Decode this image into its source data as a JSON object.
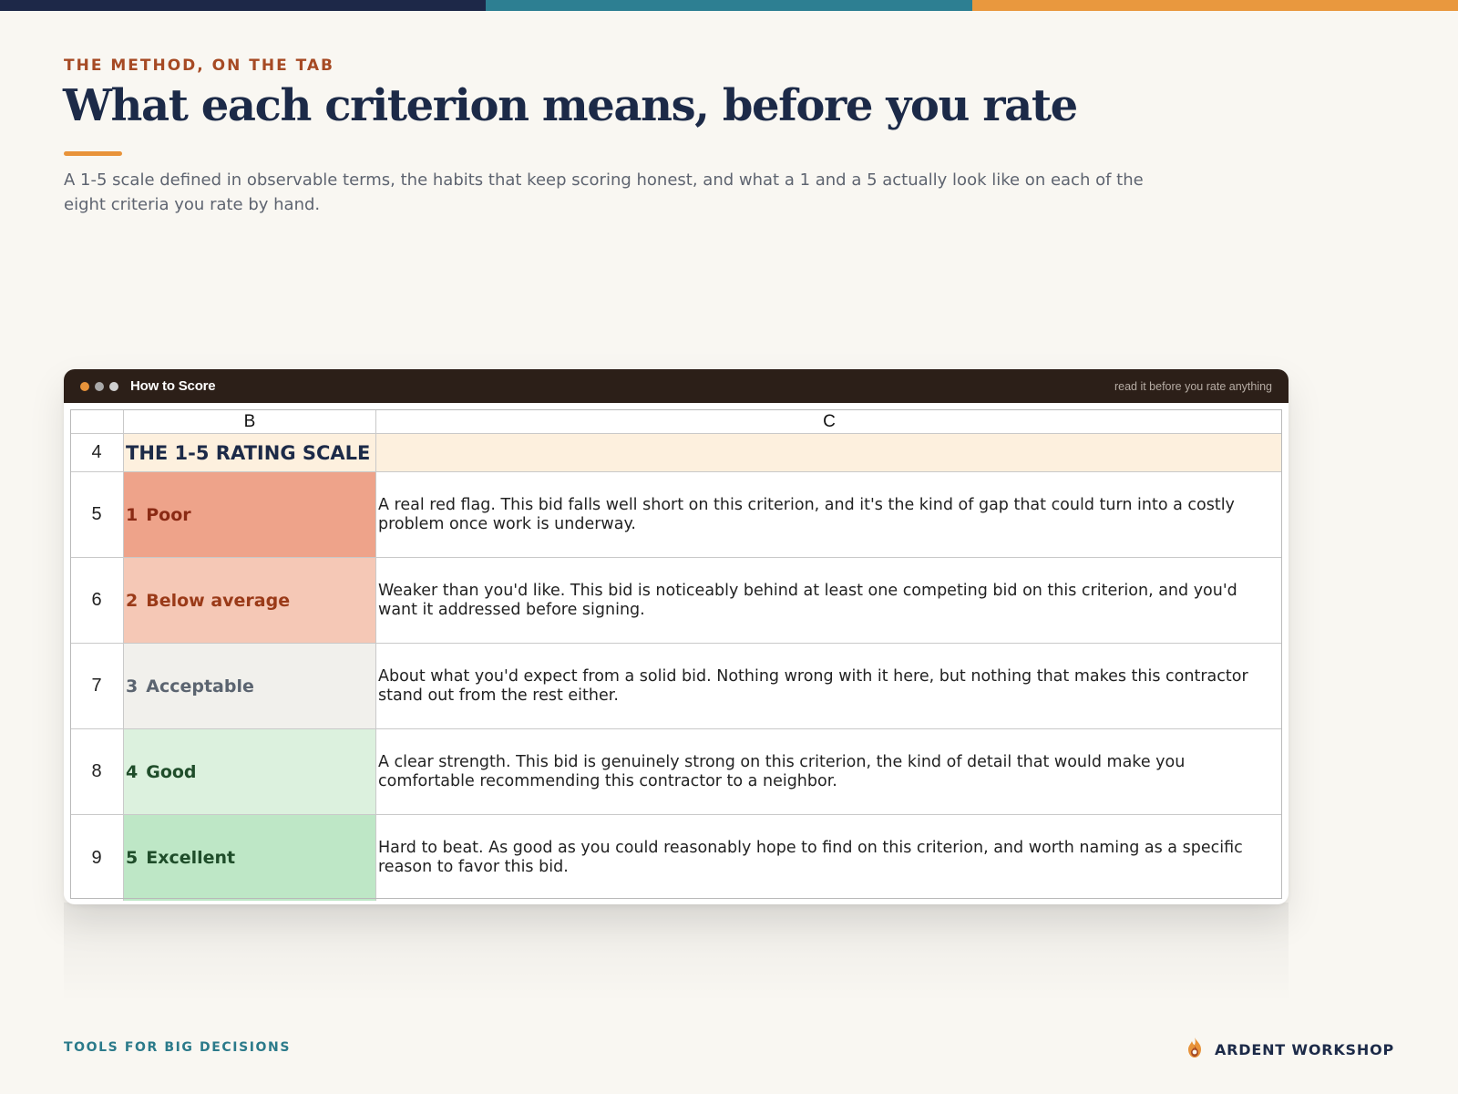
{
  "colors": {
    "top_bar": [
      "#1d2848",
      "#2d7f92",
      "#e9983e"
    ],
    "window_dots": [
      "#e8933a",
      "#a9a9a9",
      "#d0d0d0"
    ]
  },
  "header": {
    "eyebrow": "THE METHOD, ON THE TAB",
    "title": "What each criterion means, before you rate",
    "subtitle": "A 1-5 scale defined in observable terms, the habits that keep scoring honest, and what a 1 and a 5 actually look like on each of the eight criteria you rate by hand."
  },
  "window": {
    "title": "How to Score",
    "note": "read it before you rate anything"
  },
  "sheet": {
    "columns": [
      "B",
      "C"
    ],
    "section": {
      "row": "4",
      "title": "THE 1-5 RATING SCALE",
      "fill": "#fdf0de"
    },
    "rows": [
      {
        "row": "5",
        "num": "1",
        "label": "Poor",
        "fill": "#eea38a",
        "text_color": "#8a2a14",
        "description": "A real red flag. This bid falls well short on this criterion, and it's the kind of gap that could turn into a costly problem once work is underway."
      },
      {
        "row": "6",
        "num": "2",
        "label": "Below average",
        "fill": "#f5c8b6",
        "text_color": "#9a3a18",
        "description": "Weaker than you'd like. This bid is noticeably behind at least one competing bid on this criterion, and you'd want it addressed before signing."
      },
      {
        "row": "7",
        "num": "3",
        "label": "Acceptable",
        "fill": "#f1f0ec",
        "text_color": "#5b6470",
        "description": "About what you'd expect from a solid bid. Nothing wrong with it here, but nothing that makes this contractor stand out from the rest either."
      },
      {
        "row": "8",
        "num": "4",
        "label": "Good",
        "fill": "#dcf1de",
        "text_color": "#1f4d2a",
        "description": "A clear strength. This bid is genuinely strong on this criterion, the kind of detail that would make you comfortable recommending this contractor to a neighbor."
      },
      {
        "row": "9",
        "num": "5",
        "label": "Excellent",
        "fill": "#bee7c6",
        "text_color": "#1f4d2a",
        "description": "Hard to beat. As good as you could reasonably hope to find on this criterion, and worth naming as a specific reason to favor this bid."
      }
    ]
  },
  "footer": {
    "left": "TOOLS FOR BIG DECISIONS",
    "brand": "ARDENT WORKSHOP",
    "logo_icon": "flame-icon"
  }
}
